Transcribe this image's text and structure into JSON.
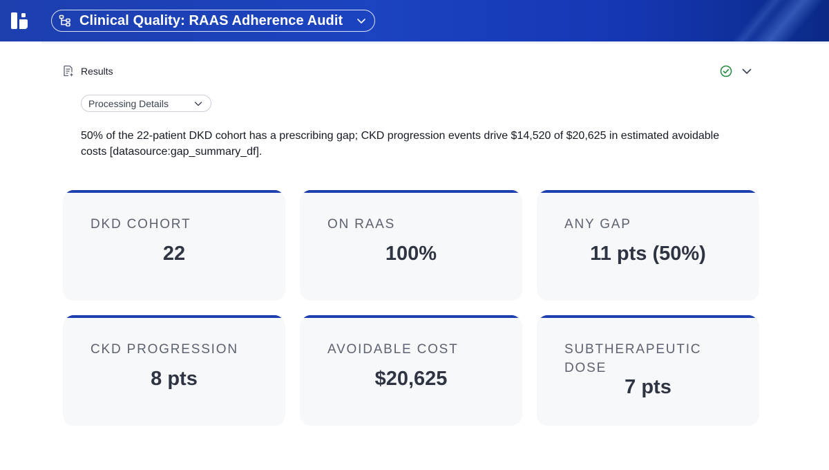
{
  "header": {
    "title": "Clinical Quality: RAAS Adherence Audit",
    "colors": {
      "bar_start": "#1d3fae",
      "bar_end": "#0b2a86"
    }
  },
  "results": {
    "label": "Results",
    "status": "complete"
  },
  "processing": {
    "label": "Processing Details"
  },
  "summary": {
    "text": "50% of the 22-patient DKD cohort has a prescribing gap; CKD progression events drive $14,520 of $20,625 in estimated avoidable costs [datasource:gap_summary_df]."
  },
  "cards": [
    {
      "label": "DKD COHORT",
      "value": "22"
    },
    {
      "label": "ON RAAS",
      "value": "100%"
    },
    {
      "label": "ANY GAP",
      "value": "11 pts (50%)"
    },
    {
      "label": "CKD PROGRESSION",
      "value": "8 pts"
    },
    {
      "label": "AVOIDABLE COST",
      "value": "$20,625"
    },
    {
      "label": "SUBTHERAPEUTIC DOSE",
      "value": "7 pts"
    }
  ],
  "accent_color": "#1e3fae",
  "status_color": "#1f8a3a"
}
